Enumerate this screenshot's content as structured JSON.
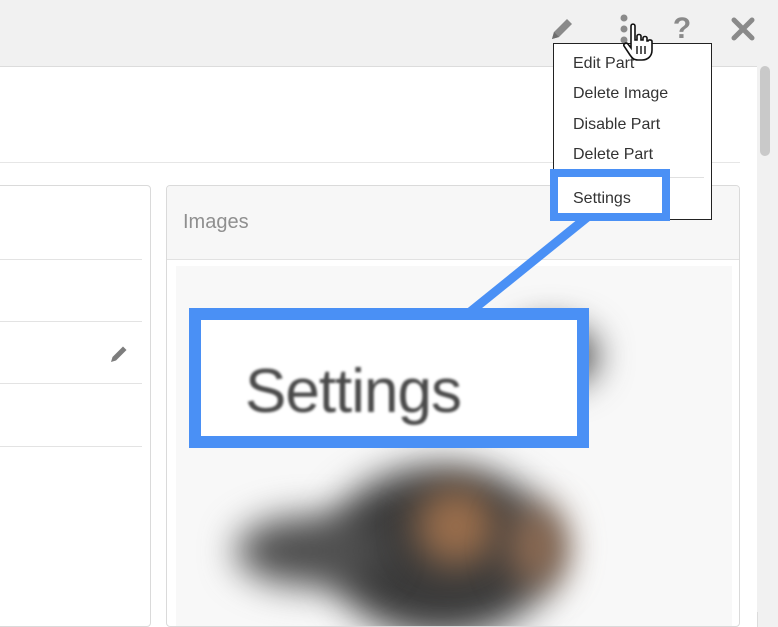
{
  "toolbar": {
    "icons": [
      "pencil-icon",
      "more-vertical-icon",
      "question-icon",
      "close-icon"
    ],
    "help_glyph": "?"
  },
  "images_card": {
    "title": "Images"
  },
  "menu": {
    "items": [
      "Edit Part",
      "Delete Image",
      "Disable Part",
      "Delete Part",
      "Settings"
    ]
  },
  "zoom": {
    "label": "Settings"
  },
  "colors": {
    "highlight": "#4a90f5",
    "icon_gray": "#8a8a8a"
  }
}
